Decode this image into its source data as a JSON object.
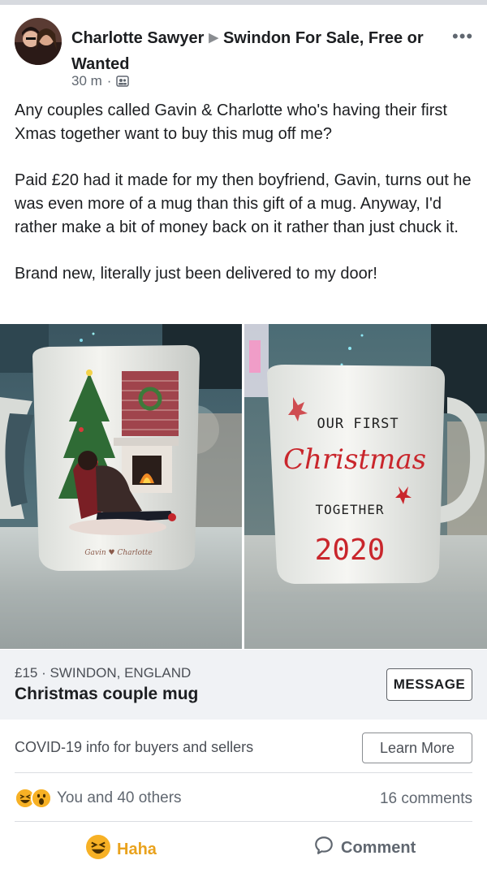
{
  "post": {
    "author": "Charlotte Sawyer",
    "group": "Swindon For Sale, Free or Wanted",
    "time": "30 m",
    "separator": "·",
    "privacy_icon": "group-members-icon",
    "more_icon": "more-options-icon",
    "paragraphs": [
      "Any couples called Gavin & Charlotte who's having their first Xmas together want to buy this mug off me?",
      "Paid £20 had it made for my then boyfriend, Gavin, turns out he was even more of a mug than this gift of a mug. Anyway, I'd rather make a bit of money back on it rather than just chuck it.",
      "Brand new, literally just been delivered to my door!"
    ],
    "photos": {
      "left": {
        "names": "Gavin ♥ Charlotte"
      },
      "right": {
        "line1": "OUR FIRST",
        "line2": "Christmas",
        "line3": "TOGETHER",
        "line4": "2020"
      }
    }
  },
  "listing": {
    "price_location": "£15 · SWINDON, ENGLAND",
    "title": "Christmas couple mug",
    "message_label": "MESSAGE"
  },
  "covid": {
    "text": "COVID-19 info for buyers and sellers",
    "learn_more": "Learn More"
  },
  "engagement": {
    "reactions_text": "You and 40 others",
    "reaction_icons": [
      "haha-icon",
      "wow-icon"
    ],
    "comments": "16 comments"
  },
  "actions": {
    "haha_label": "Haha",
    "comment_label": "Comment"
  },
  "colors": {
    "haha": "#e9a21d",
    "mug_red": "#c9262c",
    "meta_gray": "#606770"
  }
}
